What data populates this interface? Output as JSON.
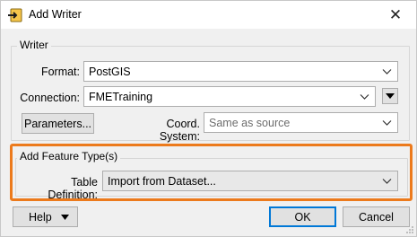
{
  "window": {
    "title": "Add Writer",
    "icon": "add-writer-icon",
    "close_glyph": "✕"
  },
  "writer_group": {
    "label": "Writer",
    "format_label": "Format:",
    "format_value": "PostGIS",
    "connection_label": "Connection:",
    "connection_value": "FMETraining",
    "parameters_button": "Parameters...",
    "coord_system_label": "Coord. System:",
    "coord_system_placeholder": "Same as source"
  },
  "feature_group": {
    "label": "Add Feature Type(s)",
    "table_definition_label": "Table Definition:",
    "table_definition_value": "Import from Dataset..."
  },
  "footer": {
    "help_button": "Help",
    "ok_button": "OK",
    "cancel_button": "Cancel"
  },
  "colors": {
    "highlight": "#ec7a1c",
    "primary_border": "#0078d7"
  }
}
